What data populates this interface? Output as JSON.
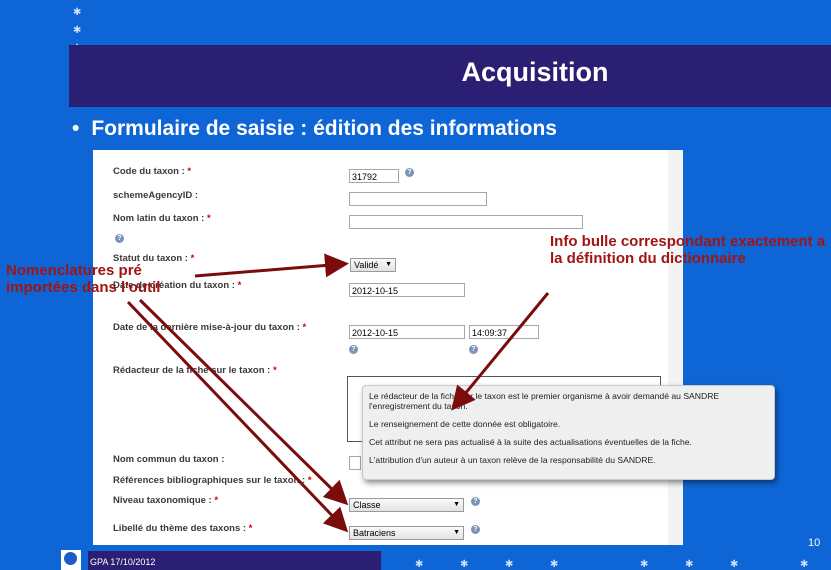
{
  "slide": {
    "title": "Acquisition",
    "bullet": "Formulaire de saisie : édition des informations",
    "footer_date": "GPA 17/10/2012",
    "page_number": "10"
  },
  "form": {
    "req_mark": "*",
    "code_taxon": {
      "label": "Code du taxon :",
      "value": "31792"
    },
    "scheme_agency": {
      "label": "schemeAgencyID :",
      "value": ""
    },
    "nom_latin": {
      "label": "Nom latin du taxon :",
      "value": ""
    },
    "statut": {
      "label": "Statut du taxon :",
      "value": "Validé"
    },
    "date_creation": {
      "label": "Date de création du taxon :",
      "value": "2012-10-15"
    },
    "date_maj": {
      "label": "Date de la dernière mise-à-jour du taxon :",
      "date": "2012-10-15",
      "time": "14:09:37"
    },
    "redacteur": {
      "label": "Rédacteur de la fiche sur le taxon :"
    },
    "nom_commun": {
      "label": "Nom commun du taxon :"
    },
    "references": {
      "label": "Références bibliographiques sur le taxon :"
    },
    "niveau": {
      "label": "Niveau taxonomique :",
      "value": "Classe"
    },
    "libelle_theme": {
      "label": "Libellé du thème des taxons :",
      "value": "Batraciens"
    }
  },
  "tooltip": {
    "p1": "Le rédacteur de la fiche sur le taxon est le premier organisme à avoir demandé au SANDRE l'enregistrement du taxon.",
    "p2": "Le renseignement de cette donnée est obligatoire.",
    "p3": "Cet attribut ne sera pas actualisé à la suite des actualisations éventuelles de la fiche.",
    "p4": "L'attribution d'un auteur à un taxon relève de la responsabilité du SANDRE."
  },
  "annotations": {
    "left": "Nomenclatures pré importées dans l'outil",
    "right": "Info bulle correspondant exactement a la définition du dictionnaire"
  },
  "colors": {
    "background": "#0e66d6",
    "band": "#2a1f72",
    "annotation": "#a01414"
  }
}
